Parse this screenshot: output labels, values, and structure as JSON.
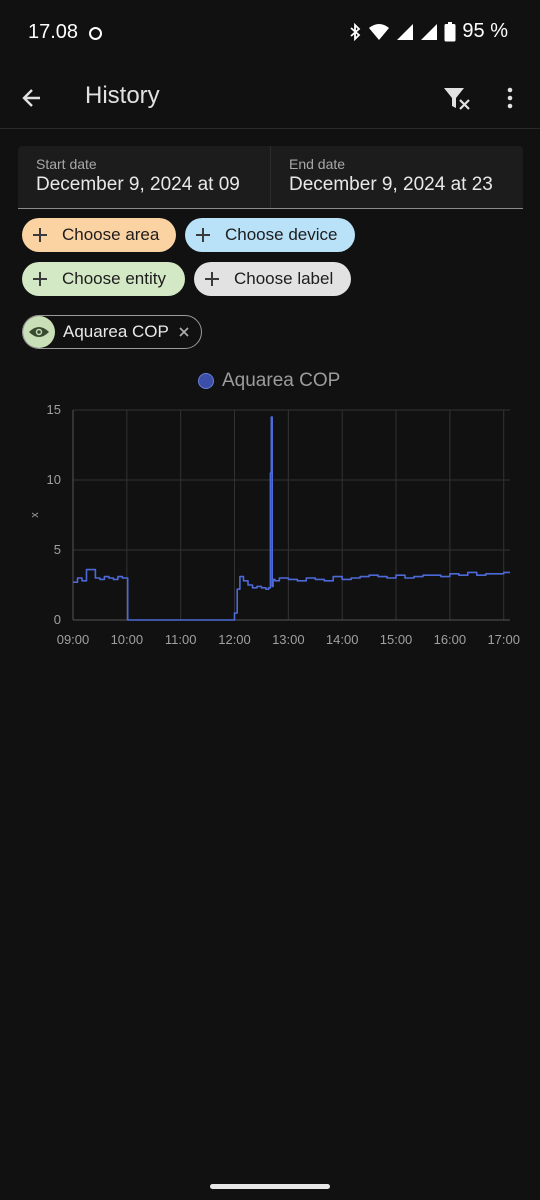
{
  "status_bar": {
    "time": "17.08",
    "battery": "95 %",
    "icons": [
      "bluetooth-icon",
      "wifi-icon",
      "signal-icon",
      "signal-icon",
      "battery-icon"
    ]
  },
  "app_bar": {
    "title": "History",
    "back_icon": "arrow-back-icon",
    "filter_icon": "filter-remove-icon",
    "more_icon": "more-vert-icon"
  },
  "date_range": {
    "start_label": "Start date",
    "start_value": "December 9, 2024 at 09",
    "end_label": "End date",
    "end_value": "December 9, 2024 at 23"
  },
  "target_chips": [
    {
      "label": "Choose area",
      "color": "#fbd3a3"
    },
    {
      "label": "Choose device",
      "color": "#b9e2f8"
    },
    {
      "label": "Choose entity",
      "color": "#d3e8c4"
    },
    {
      "label": "Choose label",
      "color": "#e2e2e2"
    }
  ],
  "selected_entity": {
    "label": "Aquarea COP",
    "icon": "eye-icon"
  },
  "chart_data": {
    "type": "line",
    "legend": [
      "Aquarea COP"
    ],
    "ylabel": "x",
    "ylim": [
      0,
      15
    ],
    "y_ticks": [
      "0",
      "5",
      "10",
      "15"
    ],
    "x_ticks": [
      "09:00",
      "10:00",
      "11:00",
      "12:00",
      "13:00",
      "14:00",
      "15:00",
      "16:00",
      "17:00"
    ],
    "grid": true,
    "color": "#4d6ad8",
    "series": [
      {
        "name": "Aquarea COP",
        "x": [
          "09:00",
          "09:05",
          "09:10",
          "09:15",
          "09:20",
          "09:25",
          "09:30",
          "09:35",
          "09:40",
          "09:45",
          "09:50",
          "09:55",
          "10:00",
          "10:01",
          "10:30",
          "11:00",
          "11:30",
          "11:59",
          "12:00",
          "12:03",
          "12:06",
          "12:10",
          "12:15",
          "12:20",
          "12:25",
          "12:30",
          "12:35",
          "12:38",
          "12:40",
          "12:41",
          "12:42",
          "12:43",
          "12:45",
          "12:50",
          "13:00",
          "13:10",
          "13:20",
          "13:30",
          "13:40",
          "13:50",
          "14:00",
          "14:10",
          "14:20",
          "14:30",
          "14:40",
          "14:50",
          "15:00",
          "15:10",
          "15:20",
          "15:30",
          "15:40",
          "15:50",
          "16:00",
          "16:10",
          "16:20",
          "16:30",
          "16:40",
          "16:50",
          "17:00",
          "17:07"
        ],
        "values": [
          2.7,
          3.0,
          2.8,
          3.6,
          3.6,
          3.0,
          2.9,
          3.1,
          3.0,
          2.9,
          3.1,
          3.0,
          3.0,
          0.0,
          0.0,
          0.0,
          0.0,
          0.0,
          0.5,
          2.2,
          3.1,
          2.8,
          2.5,
          2.3,
          2.4,
          2.3,
          2.2,
          2.3,
          10.5,
          14.5,
          2.4,
          2.9,
          2.8,
          3.0,
          2.9,
          2.8,
          3.0,
          2.9,
          2.8,
          3.1,
          2.9,
          3.0,
          3.1,
          3.2,
          3.1,
          3.0,
          3.2,
          3.0,
          3.1,
          3.2,
          3.2,
          3.1,
          3.3,
          3.2,
          3.4,
          3.2,
          3.3,
          3.3,
          3.4,
          3.4
        ]
      }
    ]
  }
}
